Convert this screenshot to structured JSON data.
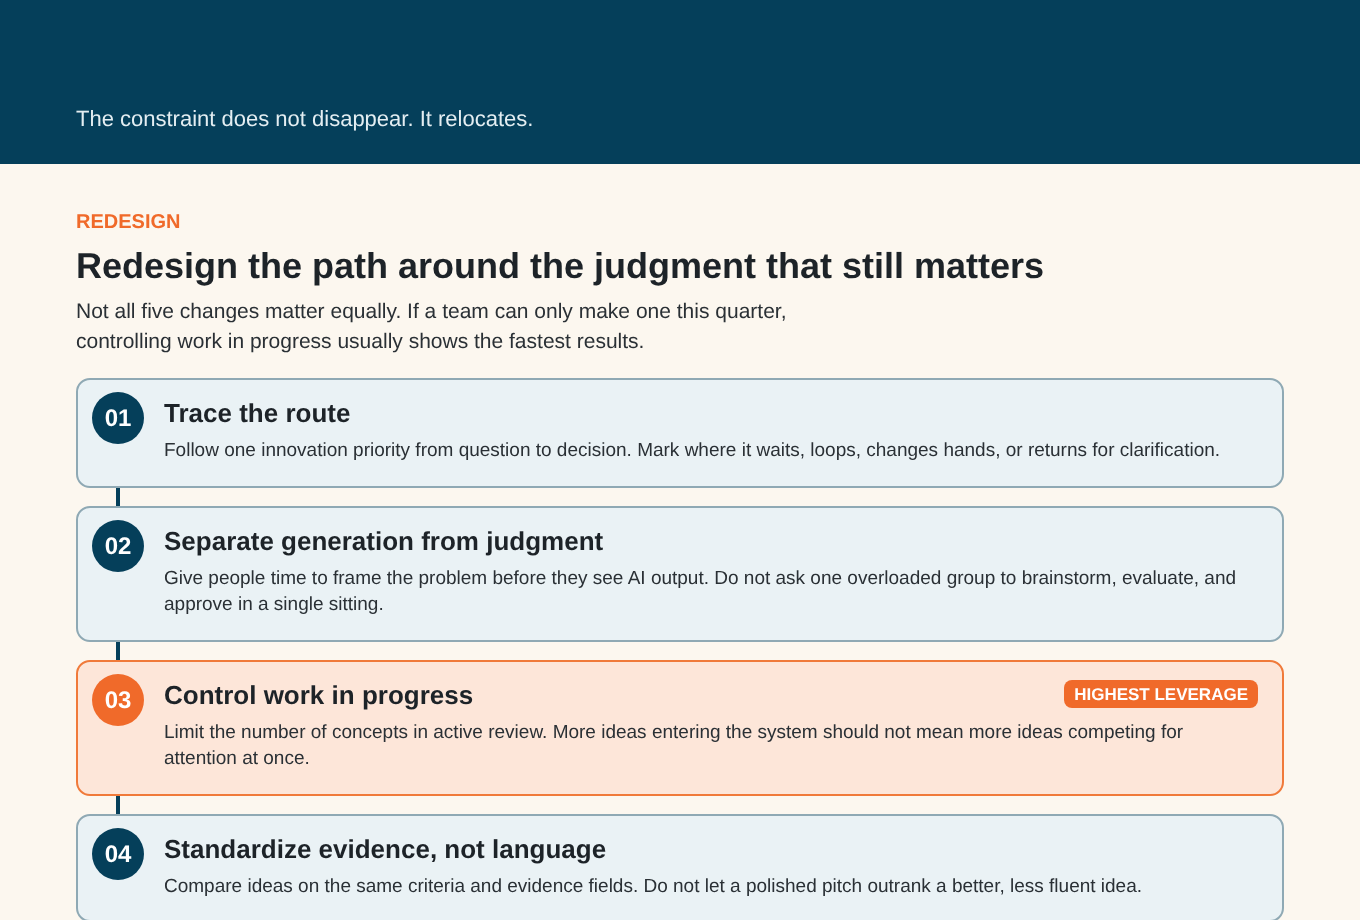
{
  "header": {
    "subtitle": "The constraint does not disappear. It relocates."
  },
  "section": {
    "eyebrow": "REDESIGN",
    "title": "Redesign the path around the judgment that still matters",
    "intro": "Not all five changes matter equally. If a team can only make one this quarter, controlling work in progress usually shows the fastest results."
  },
  "steps": [
    {
      "number": "01",
      "title": "Trace the route",
      "text": "Follow one innovation priority from question to decision. Mark where it waits, loops, changes hands, or returns for clarification.",
      "highlighted": false
    },
    {
      "number": "02",
      "title": "Separate generation from judgment",
      "text": "Give people time to frame the problem before they see AI output. Do not ask one overloaded group to brainstorm, evaluate, and approve in a single sitting.",
      "highlighted": false
    },
    {
      "number": "03",
      "title": "Control work in progress",
      "text": "Limit the number of concepts in active review. More ideas entering the system should not mean more ideas competing for attention at once.",
      "highlighted": true,
      "badge": "HIGHEST LEVERAGE"
    },
    {
      "number": "04",
      "title": "Standardize evidence, not language",
      "text": "Compare ideas on the same criteria and evidence fields. Do not let a polished pitch outrank a better, less fluent idea.",
      "highlighted": false
    }
  ]
}
